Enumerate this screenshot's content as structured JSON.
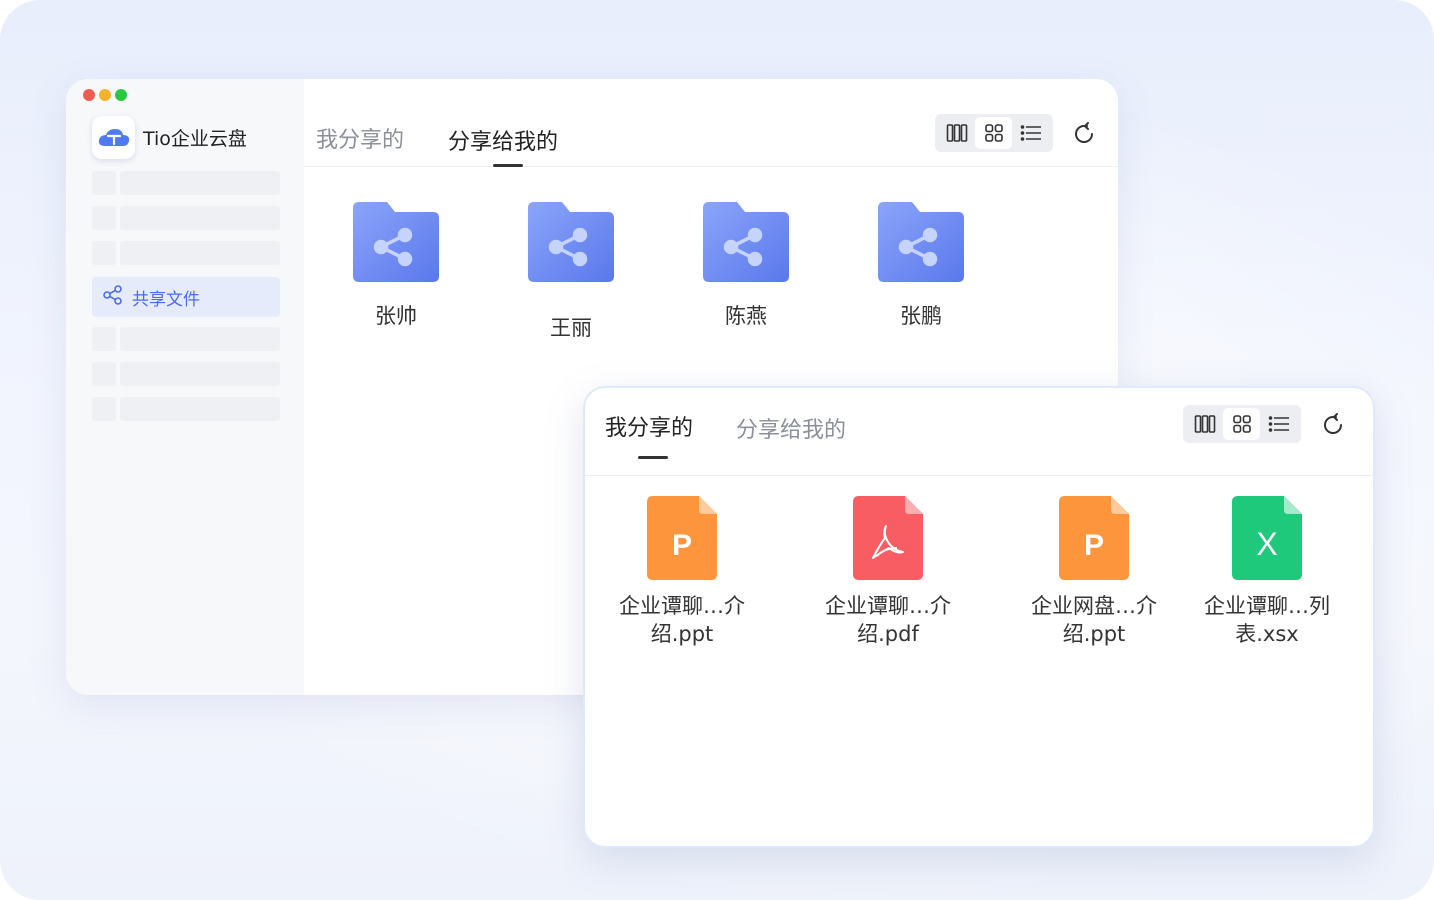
{
  "app": {
    "name": "Tio企业云盘",
    "colors": {
      "accent": "#4a6bf0",
      "folder": "#6f8ef5",
      "ppt": "#fd953c",
      "pdf": "#f75d62",
      "xls": "#1ec97b"
    }
  },
  "sidebar": {
    "active_item": {
      "label": "共享文件",
      "icon": "share-icon"
    }
  },
  "main_window": {
    "tabs": [
      {
        "label": "我分享的",
        "active": false
      },
      {
        "label": "分享给我的",
        "active": true
      }
    ],
    "view_modes": [
      "column-view-icon",
      "grid-view-icon",
      "list-view-icon"
    ],
    "selected_view": "grid-view-icon",
    "folders": [
      {
        "name": "张帅"
      },
      {
        "name": "王丽"
      },
      {
        "name": "陈燕"
      },
      {
        "name": "张鹏"
      }
    ]
  },
  "front_window": {
    "tabs": [
      {
        "label": "我分享的",
        "active": true
      },
      {
        "label": "分享给我的",
        "active": false
      }
    ],
    "view_modes": [
      "column-view-icon",
      "grid-view-icon",
      "list-view-icon"
    ],
    "selected_view": "grid-view-icon",
    "files": [
      {
        "type": "ppt",
        "glyph": "P",
        "line1": "企业谭聊…介",
        "line2": "绍.ppt"
      },
      {
        "type": "pdf",
        "glyph": "",
        "line1": "企业谭聊…介",
        "line2": "绍.pdf"
      },
      {
        "type": "ppt",
        "glyph": "P",
        "line1": "企业网盘…介",
        "line2": "绍.ppt"
      },
      {
        "type": "xls",
        "glyph": "X",
        "line1": "企业谭聊…列",
        "line2": "表.xsx"
      }
    ]
  }
}
